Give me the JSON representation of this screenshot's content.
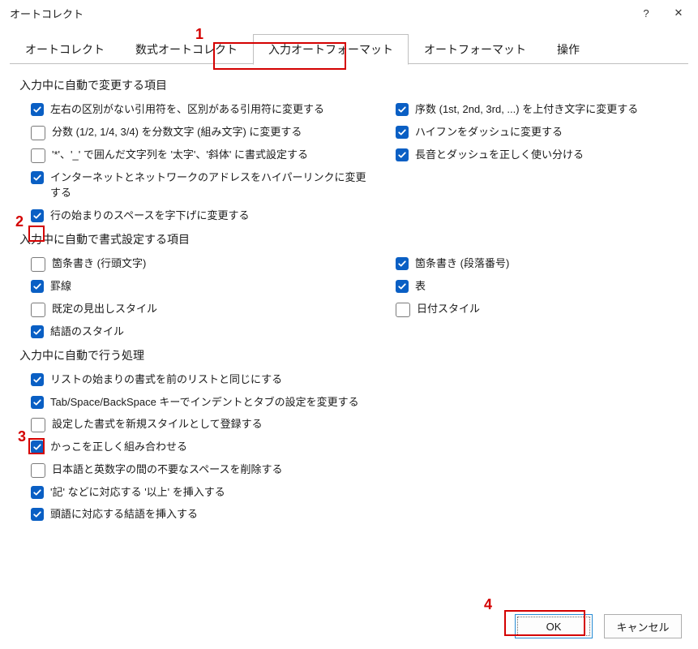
{
  "window": {
    "title": "オートコレクト",
    "help_glyph": "?",
    "close_glyph": "✕"
  },
  "tabs": [
    {
      "label": "オートコレクト",
      "active": false
    },
    {
      "label": "数式オートコレクト",
      "active": false
    },
    {
      "label": "入力オートフォーマット",
      "active": true
    },
    {
      "label": "オートフォーマット",
      "active": false
    },
    {
      "label": "操作",
      "active": false
    }
  ],
  "sections": {
    "change": {
      "title": "入力中に自動で変更する項目",
      "left": [
        {
          "name": "smart-quotes",
          "checked": true,
          "label": "左右の区別がない引用符を、区別がある引用符に変更する"
        },
        {
          "name": "fractions",
          "checked": false,
          "label": "分数 (1/2, 1/4, 3/4) を分数文字 (組み文字) に変更する"
        },
        {
          "name": "bold-italic",
          "checked": false,
          "label": "'*'、'_' で囲んだ文字列を '太字'、'斜体' に書式設定する"
        },
        {
          "name": "hyperlinks",
          "checked": true,
          "label": "インターネットとネットワークのアドレスをハイパーリンクに変更する"
        },
        {
          "name": "indent-spaces",
          "checked": true,
          "label": "行の始まりのスペースを字下げに変更する",
          "ann": 2
        }
      ],
      "right": [
        {
          "name": "ordinals",
          "checked": true,
          "label": "序数 (1st, 2nd, 3rd, ...) を上付き文字に変更する"
        },
        {
          "name": "hyphen-dash",
          "checked": true,
          "label": "ハイフンをダッシュに変更する"
        },
        {
          "name": "long-vowel-dash",
          "checked": true,
          "label": "長音とダッシュを正しく使い分ける"
        }
      ]
    },
    "format": {
      "title": "入力中に自動で書式設定する項目",
      "left": [
        {
          "name": "bullets",
          "checked": false,
          "label": "箇条書き (行頭文字)"
        },
        {
          "name": "borders",
          "checked": true,
          "label": "罫線"
        },
        {
          "name": "heading-styles",
          "checked": false,
          "label": "既定の見出しスタイル"
        },
        {
          "name": "closing-style",
          "checked": true,
          "label": "結語のスタイル"
        }
      ],
      "right": [
        {
          "name": "numbered-lists",
          "checked": true,
          "label": "箇条書き (段落番号)"
        },
        {
          "name": "tables",
          "checked": true,
          "label": "表"
        },
        {
          "name": "date-style",
          "checked": false,
          "label": "日付スタイル"
        }
      ]
    },
    "process": {
      "title": "入力中に自動で行う処理",
      "items": [
        {
          "name": "list-like-prev",
          "checked": true,
          "label": "リストの始まりの書式を前のリストと同じにする"
        },
        {
          "name": "tab-space-backspace",
          "checked": true,
          "label": "Tab/Space/BackSpace キーでインデントとタブの設定を変更する",
          "ann": 3
        },
        {
          "name": "new-style",
          "checked": false,
          "label": "設定した書式を新規スタイルとして登録する"
        },
        {
          "name": "match-brackets",
          "checked": true,
          "label": "かっこを正しく組み合わせる"
        },
        {
          "name": "trim-spaces",
          "checked": false,
          "label": "日本語と英数字の間の不要なスペースを削除する"
        },
        {
          "name": "insert-ijou",
          "checked": true,
          "label": "'記' などに対応する '以上' を挿入する"
        },
        {
          "name": "insert-closing",
          "checked": true,
          "label": "頭語に対応する結語を挿入する"
        }
      ]
    }
  },
  "footer": {
    "ok": "OK",
    "cancel": "キャンセル"
  },
  "annotations": {
    "1": "1",
    "2": "2",
    "3": "3",
    "4": "4"
  }
}
